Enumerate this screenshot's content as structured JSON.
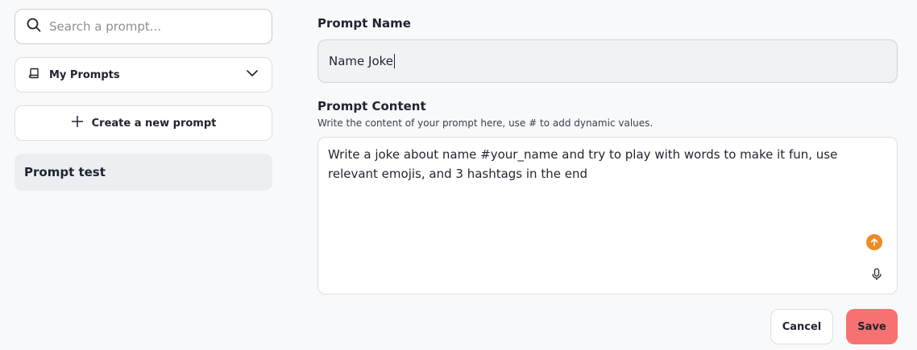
{
  "sidebar": {
    "search": {
      "placeholder": "Search a prompt...",
      "value": "",
      "icon": "search-icon"
    },
    "filter": {
      "label": "My Prompts",
      "icon": "book-icon",
      "chevron": "chevron-down-icon"
    },
    "create_button": {
      "label": "Create a new prompt",
      "icon": "plus-icon"
    },
    "prompts": [
      {
        "label": "Prompt test"
      }
    ]
  },
  "editor": {
    "name_label": "Prompt Name",
    "name_value": "Name Joke",
    "content_label": "Prompt Content",
    "content_hint": "Write the content of your prompt here, use # to add dynamic values.",
    "content_value": "Write a joke about name #your_name and try to play with words to make it fun, use relevant emojis, and 3 hashtags in the end",
    "enhance_icon": "arrow-up-icon",
    "mic_icon": "microphone-icon"
  },
  "actions": {
    "cancel_label": "Cancel",
    "save_label": "Save"
  },
  "colors": {
    "accent_orange": "#f08a24",
    "save_red": "#f87171",
    "selected_bg": "#eceef1"
  }
}
